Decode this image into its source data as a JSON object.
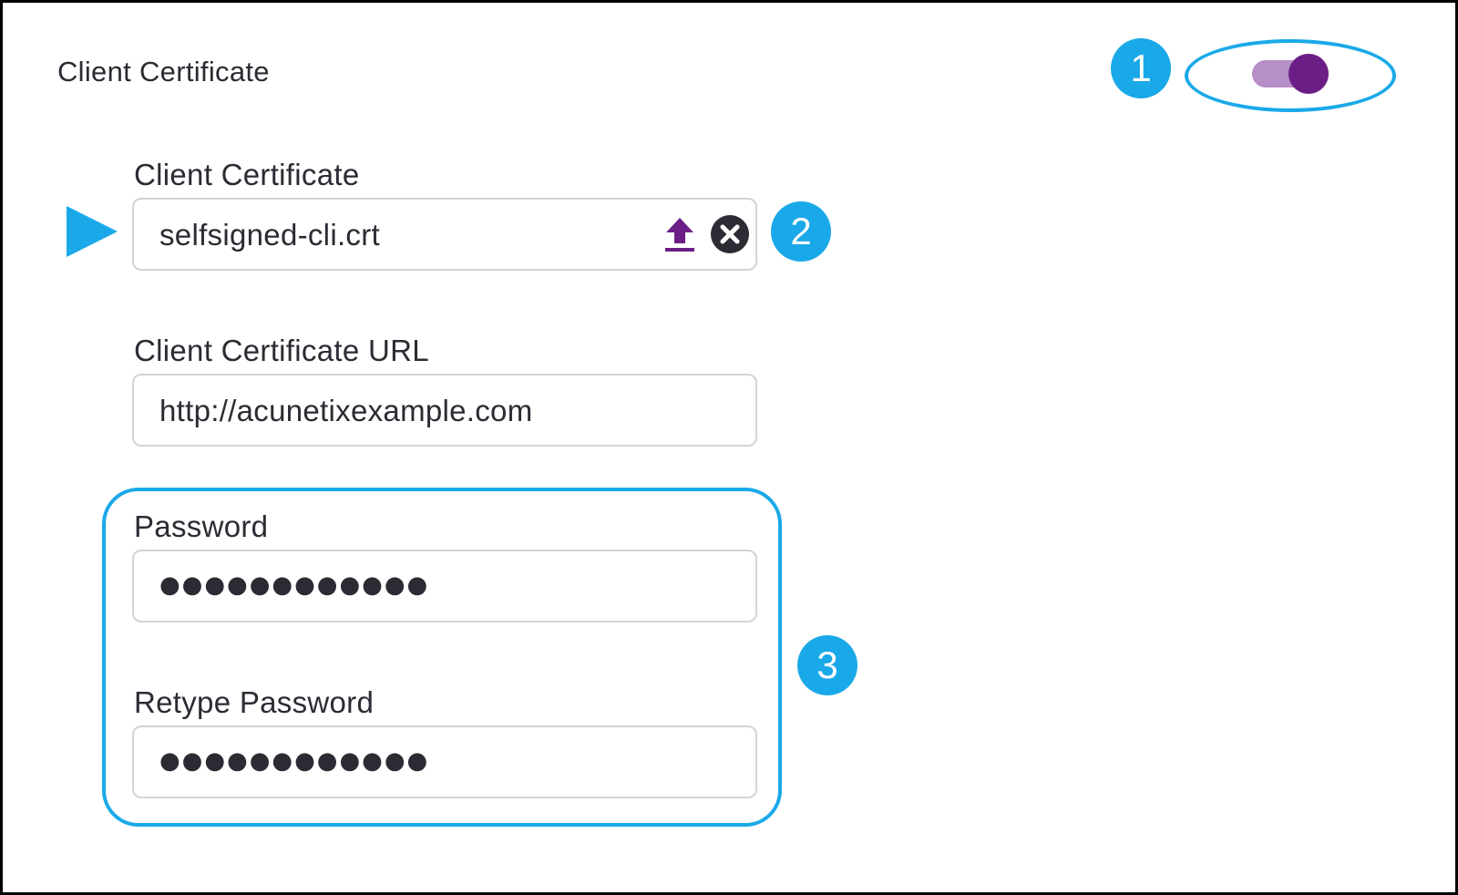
{
  "section": {
    "title": "Client Certificate",
    "toggle_enabled": true
  },
  "colors": {
    "accent_purple": "#6b1f86",
    "track_purple": "#b68fc8",
    "callout_blue": "#1aa9e8",
    "clear_dark": "#2c2c34"
  },
  "callouts": {
    "one": "1",
    "two": "2",
    "three": "3"
  },
  "fields": {
    "certificate": {
      "label": "Client Certificate",
      "value": "selfsigned-cli.crt",
      "upload_icon": "upload-icon",
      "clear_icon": "clear-icon"
    },
    "certificate_url": {
      "label": "Client Certificate URL",
      "value": "http://acunetixexample.com"
    },
    "password": {
      "label": "Password",
      "masked_value": "●●●●●●●●●●●●"
    },
    "retype_password": {
      "label": "Retype Password",
      "masked_value": "●●●●●●●●●●●●"
    }
  }
}
